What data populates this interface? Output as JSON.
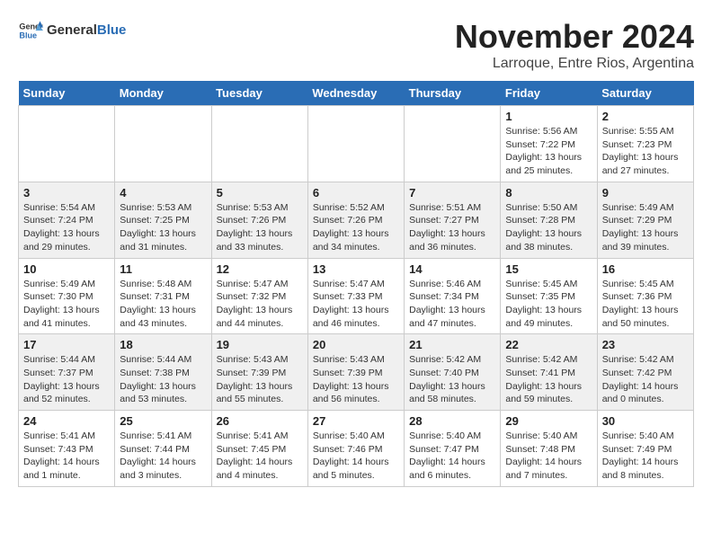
{
  "header": {
    "logo_general": "General",
    "logo_blue": "Blue",
    "month": "November 2024",
    "location": "Larroque, Entre Rios, Argentina"
  },
  "weekdays": [
    "Sunday",
    "Monday",
    "Tuesday",
    "Wednesday",
    "Thursday",
    "Friday",
    "Saturday"
  ],
  "weeks": [
    [
      {
        "day": "",
        "info": ""
      },
      {
        "day": "",
        "info": ""
      },
      {
        "day": "",
        "info": ""
      },
      {
        "day": "",
        "info": ""
      },
      {
        "day": "",
        "info": ""
      },
      {
        "day": "1",
        "info": "Sunrise: 5:56 AM\nSunset: 7:22 PM\nDaylight: 13 hours and 25 minutes."
      },
      {
        "day": "2",
        "info": "Sunrise: 5:55 AM\nSunset: 7:23 PM\nDaylight: 13 hours and 27 minutes."
      }
    ],
    [
      {
        "day": "3",
        "info": "Sunrise: 5:54 AM\nSunset: 7:24 PM\nDaylight: 13 hours and 29 minutes."
      },
      {
        "day": "4",
        "info": "Sunrise: 5:53 AM\nSunset: 7:25 PM\nDaylight: 13 hours and 31 minutes."
      },
      {
        "day": "5",
        "info": "Sunrise: 5:53 AM\nSunset: 7:26 PM\nDaylight: 13 hours and 33 minutes."
      },
      {
        "day": "6",
        "info": "Sunrise: 5:52 AM\nSunset: 7:26 PM\nDaylight: 13 hours and 34 minutes."
      },
      {
        "day": "7",
        "info": "Sunrise: 5:51 AM\nSunset: 7:27 PM\nDaylight: 13 hours and 36 minutes."
      },
      {
        "day": "8",
        "info": "Sunrise: 5:50 AM\nSunset: 7:28 PM\nDaylight: 13 hours and 38 minutes."
      },
      {
        "day": "9",
        "info": "Sunrise: 5:49 AM\nSunset: 7:29 PM\nDaylight: 13 hours and 39 minutes."
      }
    ],
    [
      {
        "day": "10",
        "info": "Sunrise: 5:49 AM\nSunset: 7:30 PM\nDaylight: 13 hours and 41 minutes."
      },
      {
        "day": "11",
        "info": "Sunrise: 5:48 AM\nSunset: 7:31 PM\nDaylight: 13 hours and 43 minutes."
      },
      {
        "day": "12",
        "info": "Sunrise: 5:47 AM\nSunset: 7:32 PM\nDaylight: 13 hours and 44 minutes."
      },
      {
        "day": "13",
        "info": "Sunrise: 5:47 AM\nSunset: 7:33 PM\nDaylight: 13 hours and 46 minutes."
      },
      {
        "day": "14",
        "info": "Sunrise: 5:46 AM\nSunset: 7:34 PM\nDaylight: 13 hours and 47 minutes."
      },
      {
        "day": "15",
        "info": "Sunrise: 5:45 AM\nSunset: 7:35 PM\nDaylight: 13 hours and 49 minutes."
      },
      {
        "day": "16",
        "info": "Sunrise: 5:45 AM\nSunset: 7:36 PM\nDaylight: 13 hours and 50 minutes."
      }
    ],
    [
      {
        "day": "17",
        "info": "Sunrise: 5:44 AM\nSunset: 7:37 PM\nDaylight: 13 hours and 52 minutes."
      },
      {
        "day": "18",
        "info": "Sunrise: 5:44 AM\nSunset: 7:38 PM\nDaylight: 13 hours and 53 minutes."
      },
      {
        "day": "19",
        "info": "Sunrise: 5:43 AM\nSunset: 7:39 PM\nDaylight: 13 hours and 55 minutes."
      },
      {
        "day": "20",
        "info": "Sunrise: 5:43 AM\nSunset: 7:39 PM\nDaylight: 13 hours and 56 minutes."
      },
      {
        "day": "21",
        "info": "Sunrise: 5:42 AM\nSunset: 7:40 PM\nDaylight: 13 hours and 58 minutes."
      },
      {
        "day": "22",
        "info": "Sunrise: 5:42 AM\nSunset: 7:41 PM\nDaylight: 13 hours and 59 minutes."
      },
      {
        "day": "23",
        "info": "Sunrise: 5:42 AM\nSunset: 7:42 PM\nDaylight: 14 hours and 0 minutes."
      }
    ],
    [
      {
        "day": "24",
        "info": "Sunrise: 5:41 AM\nSunset: 7:43 PM\nDaylight: 14 hours and 1 minute."
      },
      {
        "day": "25",
        "info": "Sunrise: 5:41 AM\nSunset: 7:44 PM\nDaylight: 14 hours and 3 minutes."
      },
      {
        "day": "26",
        "info": "Sunrise: 5:41 AM\nSunset: 7:45 PM\nDaylight: 14 hours and 4 minutes."
      },
      {
        "day": "27",
        "info": "Sunrise: 5:40 AM\nSunset: 7:46 PM\nDaylight: 14 hours and 5 minutes."
      },
      {
        "day": "28",
        "info": "Sunrise: 5:40 AM\nSunset: 7:47 PM\nDaylight: 14 hours and 6 minutes."
      },
      {
        "day": "29",
        "info": "Sunrise: 5:40 AM\nSunset: 7:48 PM\nDaylight: 14 hours and 7 minutes."
      },
      {
        "day": "30",
        "info": "Sunrise: 5:40 AM\nSunset: 7:49 PM\nDaylight: 14 hours and 8 minutes."
      }
    ]
  ]
}
